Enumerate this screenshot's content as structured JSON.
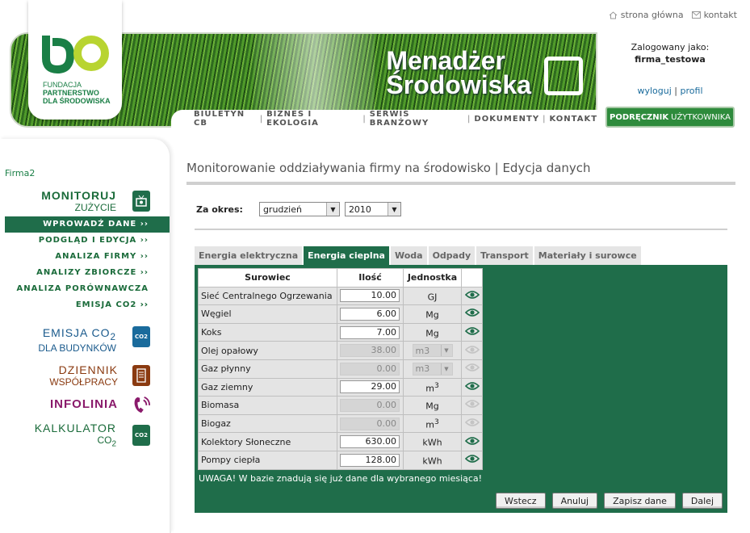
{
  "header": {
    "top_links": [
      "strona główna",
      "kontakt"
    ],
    "brand_line1": "Menadżer",
    "brand_line2": "Środowiska",
    "nav": [
      "BIULETYN CB",
      "BIZNES I EKOLOGIA",
      "SERWIS BRANŻOWY",
      "DOKUMENTY",
      "KONTAKT"
    ],
    "logo_lines": [
      "FUNDACJA",
      "PARTNERSTWO",
      "DLA ŚRODOWISKA"
    ],
    "user_label": "Zalogowany jako:",
    "user_name": "firma_testowa",
    "logout": "wyloguj",
    "profile": "profil",
    "link_sep": "|",
    "manual_bold": "PODRĘCZNIK",
    "manual_rest": "UŻYTKOWNIKA"
  },
  "sidebar": {
    "firm": "Firma2",
    "monitoruj": {
      "t1": "MONITORUJ",
      "t2": "ZUŻYCIE"
    },
    "menu": [
      "WPROWADŹ DANE ››",
      "PODGLĄD I EDYCJA ››",
      "ANALIZA FIRMY ››",
      "ANALIZY ZBIORCZE ››",
      "ANALIZA PORÓWNAWCZA ››",
      "EMISJA CO2 ››"
    ],
    "emisja": {
      "t1": "EMISJA CO",
      "sub": "2",
      "t2": "DLA BUDYNKÓW"
    },
    "dziennik": {
      "t1": "DZIENNIK",
      "t2": "WSPÓŁPRACY"
    },
    "infolinia": "INFOLINIA",
    "kalkulator": {
      "t1": "KALKULATOR",
      "t2": "CO",
      "sub": "2"
    },
    "icon_co2": "CO2"
  },
  "main": {
    "title": "Monitorowanie oddziaływania firmy na środowisko | Edycja danych",
    "period_label": "Za okres:",
    "month": "grudzień",
    "year": "2010",
    "tabs": [
      "Energia elektryczna",
      "Energia cieplna",
      "Woda",
      "Odpady",
      "Transport",
      "Materiały i surowce"
    ],
    "table_headers": [
      "Surowiec",
      "Ilość",
      "Jednostka"
    ],
    "rows": [
      {
        "name": "Sieć Centralnego Ogrzewania",
        "qty": "10.00",
        "unit": "GJ",
        "sup": "",
        "enabled": true
      },
      {
        "name": "Węgiel",
        "qty": "6.00",
        "unit": "Mg",
        "sup": "",
        "enabled": true
      },
      {
        "name": "Koks",
        "qty": "7.00",
        "unit": "Mg",
        "sup": "",
        "enabled": true
      },
      {
        "name": "Olej opałowy",
        "qty": "38.00",
        "unit": "m3",
        "sup": "",
        "enabled": false,
        "select": true
      },
      {
        "name": "Gaz płynny",
        "qty": "0.00",
        "unit": "m3",
        "sup": "",
        "enabled": false,
        "select": true
      },
      {
        "name": "Gaz ziemny",
        "qty": "29.00",
        "unit": "m",
        "sup": "3",
        "enabled": true
      },
      {
        "name": "Biomasa",
        "qty": "0.00",
        "unit": "Mg",
        "sup": "",
        "enabled": false
      },
      {
        "name": "Biogaz",
        "qty": "0.00",
        "unit": "m",
        "sup": "3",
        "enabled": false
      },
      {
        "name": "Kolektory Słoneczne",
        "qty": "630.00",
        "unit": "kWh",
        "sup": "",
        "enabled": true
      },
      {
        "name": "Pompy ciepła",
        "qty": "128.00",
        "unit": "kWh",
        "sup": "",
        "enabled": true
      }
    ],
    "warning": "UWAGA! W bazie znadują się już dane dla wybranego miesiąca!",
    "buttons": [
      "Wstecz",
      "Anuluj",
      "Zapisz dane",
      "Dalej"
    ]
  },
  "colors": {
    "accent": "#1f6d4a",
    "brand_green": "#2e8b3c"
  }
}
